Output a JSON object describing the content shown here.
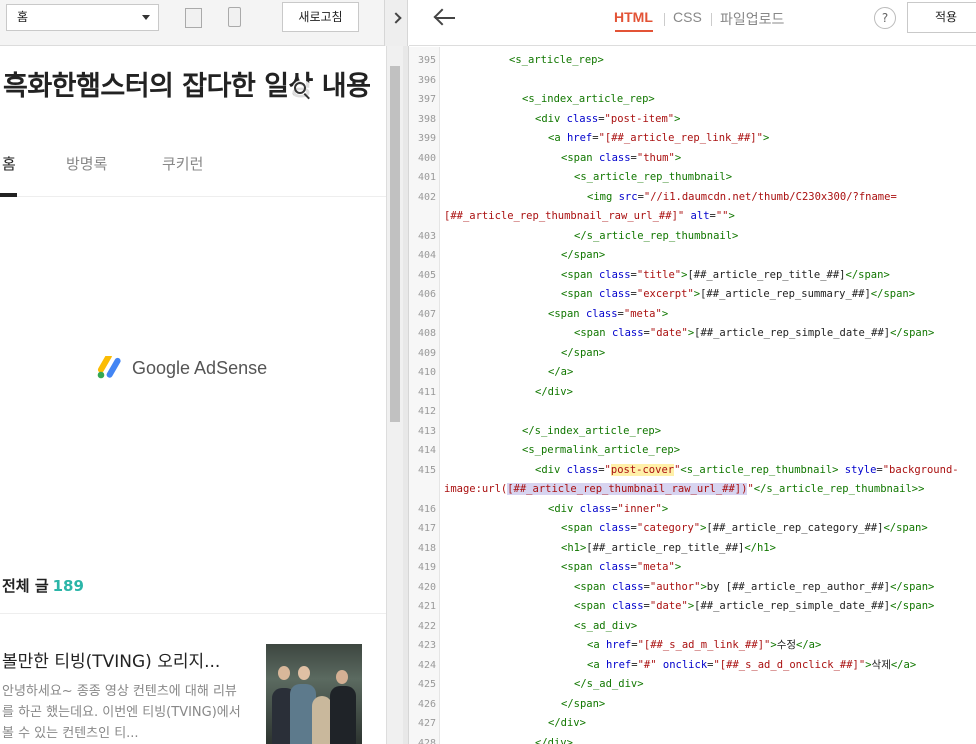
{
  "preview_toolbar": {
    "page_select": "홈",
    "refresh_label": "새로고침"
  },
  "blog": {
    "title": "흑화한햄스터의 잡다한 일상 내용",
    "nav": [
      "홈",
      "방명록",
      "쿠키런"
    ],
    "ad_text": "Google AdSense",
    "post_count_label": "전체 글",
    "post_count": "189",
    "post": {
      "title": "볼만한 티빙(TVING) 오리지...",
      "excerpt": "안녕하세요~ 종종 영상 컨텐츠에 대해 리뷰를 하곤 했는데요. 이번엔 티빙(TVING)에서 볼 수 있는 컨텐츠인 티..."
    }
  },
  "editor": {
    "tabs": [
      "HTML",
      "CSS",
      "파일업로드"
    ],
    "active_tab": "HTML",
    "help_label": "?",
    "apply_label": "적용",
    "accent_color": "#e35336",
    "lines": [
      {
        "n": "395",
        "indent": 5,
        "code": [
          [
            "tg",
            "<s_article_rep>"
          ]
        ]
      },
      {
        "n": "396",
        "indent": 0,
        "code": []
      },
      {
        "n": "397",
        "indent": 6,
        "code": [
          [
            "tg",
            "<s_index_article_rep>"
          ]
        ]
      },
      {
        "n": "398",
        "indent": 7,
        "code": [
          [
            "tg",
            "<div "
          ],
          [
            "at",
            "class"
          ],
          [
            "tx",
            "="
          ],
          [
            "st",
            "\"post-item\""
          ],
          [
            "tg",
            ">"
          ]
        ]
      },
      {
        "n": "399",
        "indent": 8,
        "code": [
          [
            "tg",
            "<a "
          ],
          [
            "at",
            "href"
          ],
          [
            "tx",
            "="
          ],
          [
            "st",
            "\"[##_article_rep_link_##]\""
          ],
          [
            "tg",
            ">"
          ]
        ]
      },
      {
        "n": "400",
        "indent": 9,
        "code": [
          [
            "tg",
            "<span "
          ],
          [
            "at",
            "class"
          ],
          [
            "tx",
            "="
          ],
          [
            "st",
            "\"thum\""
          ],
          [
            "tg",
            ">"
          ]
        ]
      },
      {
        "n": "401",
        "indent": 10,
        "code": [
          [
            "tg",
            "<s_article_rep_thumbnail>"
          ]
        ]
      },
      {
        "n": "402",
        "indent": 11,
        "code": [
          [
            "tg",
            "<img "
          ],
          [
            "at",
            "src"
          ],
          [
            "tx",
            "="
          ],
          [
            "st",
            "\"//i1.daumcdn.net/thumb/C230x300/?fname="
          ]
        ]
      },
      {
        "n": "",
        "indent": 0,
        "code": [
          [
            "st",
            "[##_article_rep_thumbnail_raw_url_##]\""
          ],
          [
            "tx",
            " "
          ],
          [
            "at",
            "alt"
          ],
          [
            "tx",
            "="
          ],
          [
            "st",
            "\"\""
          ],
          [
            "tg",
            ">"
          ]
        ]
      },
      {
        "n": "403",
        "indent": 10,
        "code": [
          [
            "tg",
            "</s_article_rep_thumbnail>"
          ]
        ]
      },
      {
        "n": "404",
        "indent": 9,
        "code": [
          [
            "tg",
            "</span>"
          ]
        ]
      },
      {
        "n": "405",
        "indent": 9,
        "code": [
          [
            "tg",
            "<span "
          ],
          [
            "at",
            "class"
          ],
          [
            "tx",
            "="
          ],
          [
            "st",
            "\"title\""
          ],
          [
            "tg",
            ">"
          ],
          [
            "tx",
            "[##_article_rep_title_##]"
          ],
          [
            "tg",
            "</span>"
          ]
        ]
      },
      {
        "n": "406",
        "indent": 9,
        "code": [
          [
            "tg",
            "<span "
          ],
          [
            "at",
            "class"
          ],
          [
            "tx",
            "="
          ],
          [
            "st",
            "\"excerpt\""
          ],
          [
            "tg",
            ">"
          ],
          [
            "tx",
            "[##_article_rep_summary_##]"
          ],
          [
            "tg",
            "</span>"
          ]
        ]
      },
      {
        "n": "407",
        "indent": 8,
        "code": [
          [
            "tg",
            "<span "
          ],
          [
            "at",
            "class"
          ],
          [
            "tx",
            "="
          ],
          [
            "st",
            "\"meta\""
          ],
          [
            "tg",
            ">"
          ]
        ]
      },
      {
        "n": "408",
        "indent": 10,
        "code": [
          [
            "tg",
            "<span "
          ],
          [
            "at",
            "class"
          ],
          [
            "tx",
            "="
          ],
          [
            "st",
            "\"date\""
          ],
          [
            "tg",
            ">"
          ],
          [
            "tx",
            "[##_article_rep_simple_date_##]"
          ],
          [
            "tg",
            "</span>"
          ]
        ]
      },
      {
        "n": "409",
        "indent": 9,
        "code": [
          [
            "tg",
            "</span>"
          ]
        ]
      },
      {
        "n": "410",
        "indent": 8,
        "code": [
          [
            "tg",
            "</a>"
          ]
        ]
      },
      {
        "n": "411",
        "indent": 7,
        "code": [
          [
            "tg",
            "</div>"
          ]
        ]
      },
      {
        "n": "412",
        "indent": 0,
        "code": []
      },
      {
        "n": "413",
        "indent": 6,
        "code": [
          [
            "tg",
            "</s_index_article_rep>"
          ]
        ]
      },
      {
        "n": "414",
        "indent": 6,
        "code": [
          [
            "tg",
            "<s_permalink_article_rep>"
          ]
        ]
      },
      {
        "n": "415",
        "indent": 7,
        "code": [
          [
            "tg",
            "<div "
          ],
          [
            "at",
            "class"
          ],
          [
            "tx",
            "="
          ],
          [
            "st",
            "\""
          ],
          [
            "st hl",
            "post-cover"
          ],
          [
            "st",
            "\""
          ],
          [
            "tg",
            "<s_article_rep_thumbnail> "
          ],
          [
            "at",
            "style"
          ],
          [
            "tx",
            "="
          ],
          [
            "st",
            "\"background-"
          ]
        ]
      },
      {
        "n": "",
        "indent": 0,
        "code": [
          [
            "st",
            "image:url("
          ],
          [
            "st sel",
            "[##_article_rep_thumbnail_raw_url_##])"
          ],
          [
            "st",
            "\""
          ],
          [
            "tg",
            "</s_article_rep_thumbnail>>"
          ]
        ]
      },
      {
        "n": "416",
        "indent": 8,
        "code": [
          [
            "tg",
            "<div "
          ],
          [
            "at",
            "class"
          ],
          [
            "tx",
            "="
          ],
          [
            "st",
            "\"inner\""
          ],
          [
            "tg",
            ">"
          ]
        ]
      },
      {
        "n": "417",
        "indent": 9,
        "code": [
          [
            "tg",
            "<span "
          ],
          [
            "at",
            "class"
          ],
          [
            "tx",
            "="
          ],
          [
            "st",
            "\"category\""
          ],
          [
            "tg",
            ">"
          ],
          [
            "tx",
            "[##_article_rep_category_##]"
          ],
          [
            "tg",
            "</span>"
          ]
        ]
      },
      {
        "n": "418",
        "indent": 9,
        "code": [
          [
            "tg",
            "<h1>"
          ],
          [
            "tx",
            "[##_article_rep_title_##]"
          ],
          [
            "tg",
            "</h1>"
          ]
        ]
      },
      {
        "n": "419",
        "indent": 9,
        "code": [
          [
            "tg",
            "<span "
          ],
          [
            "at",
            "class"
          ],
          [
            "tx",
            "="
          ],
          [
            "st",
            "\"meta\""
          ],
          [
            "tg",
            ">"
          ]
        ]
      },
      {
        "n": "420",
        "indent": 10,
        "code": [
          [
            "tg",
            "<span "
          ],
          [
            "at",
            "class"
          ],
          [
            "tx",
            "="
          ],
          [
            "st",
            "\"author\""
          ],
          [
            "tg",
            ">"
          ],
          [
            "tx",
            "by [##_article_rep_author_##]"
          ],
          [
            "tg",
            "</span>"
          ]
        ]
      },
      {
        "n": "421",
        "indent": 10,
        "code": [
          [
            "tg",
            "<span "
          ],
          [
            "at",
            "class"
          ],
          [
            "tx",
            "="
          ],
          [
            "st",
            "\"date\""
          ],
          [
            "tg",
            ">"
          ],
          [
            "tx",
            "[##_article_rep_simple_date_##]"
          ],
          [
            "tg",
            "</span>"
          ]
        ]
      },
      {
        "n": "422",
        "indent": 10,
        "code": [
          [
            "tg",
            "<s_ad_div>"
          ]
        ]
      },
      {
        "n": "423",
        "indent": 11,
        "code": [
          [
            "tg",
            "<a "
          ],
          [
            "at",
            "href"
          ],
          [
            "tx",
            "="
          ],
          [
            "st",
            "\"[##_s_ad_m_link_##]\""
          ],
          [
            "tg",
            ">"
          ],
          [
            "tx",
            "수정"
          ],
          [
            "tg",
            "</a>"
          ]
        ]
      },
      {
        "n": "424",
        "indent": 11,
        "code": [
          [
            "tg",
            "<a "
          ],
          [
            "at",
            "href"
          ],
          [
            "tx",
            "="
          ],
          [
            "st",
            "\"#\""
          ],
          [
            "tx",
            " "
          ],
          [
            "at",
            "onclick"
          ],
          [
            "tx",
            "="
          ],
          [
            "st",
            "\"[##_s_ad_d_onclick_##]\""
          ],
          [
            "tg",
            ">"
          ],
          [
            "tx",
            "삭제"
          ],
          [
            "tg",
            "</a>"
          ]
        ]
      },
      {
        "n": "425",
        "indent": 10,
        "code": [
          [
            "tg",
            "</s_ad_div>"
          ]
        ]
      },
      {
        "n": "426",
        "indent": 9,
        "code": [
          [
            "tg",
            "</span>"
          ]
        ]
      },
      {
        "n": "427",
        "indent": 8,
        "code": [
          [
            "tg",
            "</div>"
          ]
        ]
      },
      {
        "n": "428",
        "indent": 7,
        "code": [
          [
            "tg",
            "</div>"
          ]
        ]
      }
    ]
  }
}
